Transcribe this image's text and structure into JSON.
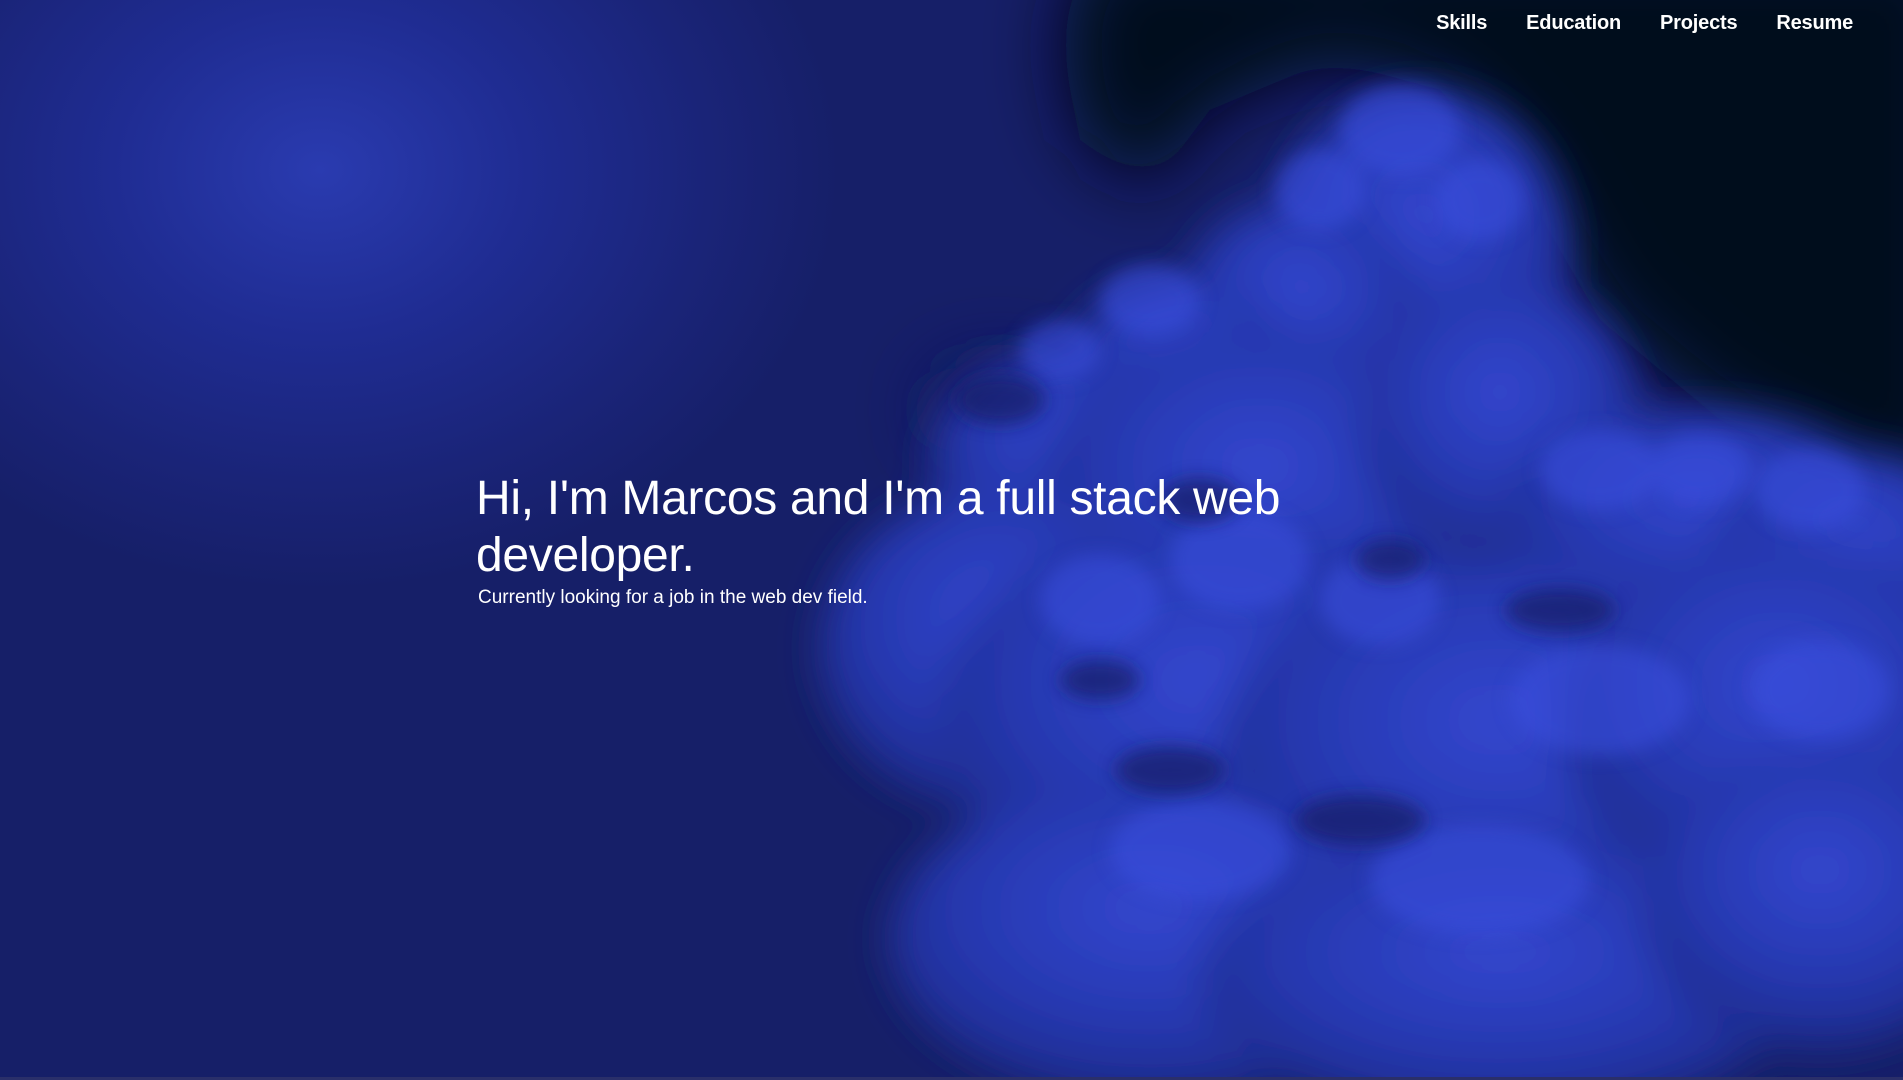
{
  "nav": {
    "links": [
      {
        "label": "Skills"
      },
      {
        "label": "Education"
      },
      {
        "label": "Projects"
      },
      {
        "label": "Resume"
      }
    ]
  },
  "hero": {
    "headline_line1": "Hi, I'm Marcos and I'm a full stack web",
    "headline_line2": "developer.",
    "subtitle": "Currently looking for a job in the web dev field.",
    "background_image": "night-clouds-image"
  },
  "colors": {
    "background": "#1a2470",
    "sky_dark": "#05081a",
    "cloud_highlight": "#3548d8",
    "text": "#ffffff"
  }
}
